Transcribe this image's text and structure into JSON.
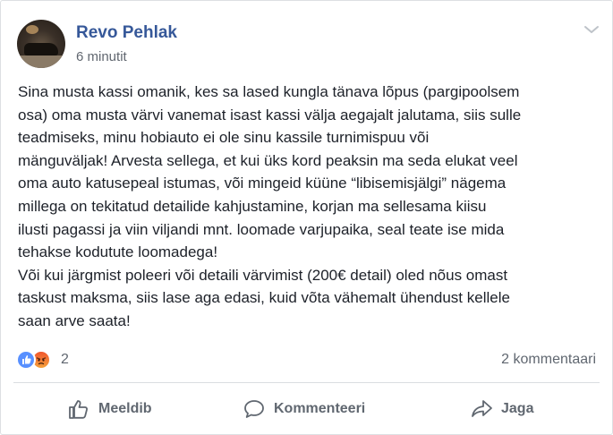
{
  "post": {
    "author": "Revo Pehlak",
    "time": "6 minutit",
    "text": "Sina musta kassi omanik, kes sa lased kungla tänava lõpus (pargipoolsem\nosa) oma musta värvi vanemat isast kassi välja aegajalt jalutama, siis sulle\nteadmiseks, minu hobiauto ei ole sinu kassile turnimispuu või\nmänguväljak! Arvesta sellega, et kui üks kord peaksin ma seda elukat veel\noma auto katusepeal istumas, või mingeid küüne “libisemisjälgi” nägema\nmillega on tekitatud detailide kahjustamine, korjan ma sellesama kiisu\nilusti pagassi ja viin viljandi mnt. loomade varjupaika, seal teate ise mida\ntehakse kodututе loomadega!\nVõi kui järgmist poleeri või detaili värvimist (200€ detail) oled nõus omast\ntaskust maksma, siis lase aga edasi, kuid võta vähemalt ühendust kellele\nsaan arve saata!"
  },
  "stats": {
    "reactions": [
      "like",
      "angry"
    ],
    "reaction_count": "2",
    "comments": "2 kommentaari"
  },
  "actions": {
    "like": "Meeldib",
    "comment": "Kommenteeri",
    "share": "Jaga"
  },
  "colors": {
    "author": "#365899",
    "muted": "#606770",
    "like_blue": "#5890ff",
    "angry_orange": "#f0552d"
  }
}
